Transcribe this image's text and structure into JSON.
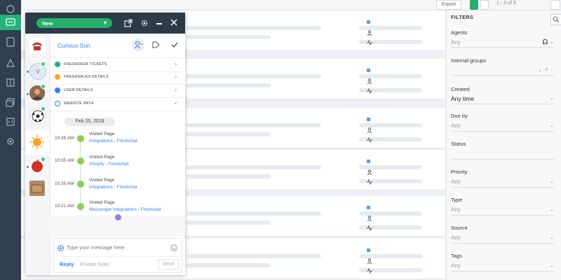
{
  "topbar": {
    "export_label": "Export",
    "pager": "1 - 3 of 3"
  },
  "widget": {
    "status_select": "New",
    "contact_name": "Curious Sun",
    "sections": [
      {
        "label": "FRESHDESK TICKETS",
        "color": "#25b06b"
      },
      {
        "label": "FRESHSALES DETAILS",
        "color": "#f5a623"
      },
      {
        "label": "USER DETAILS",
        "color": "#2d7ff9"
      },
      {
        "label": "WEBSITE PATH",
        "color": "#2d7ff9"
      }
    ],
    "date": "Feb 25, 2018",
    "timeline": [
      {
        "time": "10:35 AM",
        "title": "Visited Page",
        "link": "Integrations - Freshchat"
      },
      {
        "time": "10:35 AM",
        "title": "Visited Page",
        "link": "Shopify - Freshchat"
      },
      {
        "time": "10:35 AM",
        "title": "Visited Page",
        "link": "Integrations - Freshchat"
      },
      {
        "time": "10:21 AM",
        "title": "Visited Page",
        "link": "Messenger Integrations - Freshchat"
      }
    ],
    "composer": {
      "placeholder": "Type your message here",
      "reply_tab": "Reply",
      "private_note_tab": "Private Note",
      "send_label": "Send"
    }
  },
  "filters": {
    "title": "FILTERS",
    "fields": [
      {
        "label": "Agents",
        "value": "Any"
      },
      {
        "label": "Internal groups",
        "value": ""
      },
      {
        "label": "Created",
        "value": "Any time"
      },
      {
        "label": "Due by",
        "value": "Any"
      },
      {
        "label": "Status",
        "value": ""
      },
      {
        "label": "Priority",
        "value": "Any"
      },
      {
        "label": "Type",
        "value": "Any"
      },
      {
        "label": "Source",
        "value": "Any"
      },
      {
        "label": "Tags",
        "value": "Any"
      }
    ]
  },
  "colors": {
    "brand_green": "#25b06b",
    "link_blue": "#2d7ff9",
    "rail": "#2f3f4f"
  }
}
